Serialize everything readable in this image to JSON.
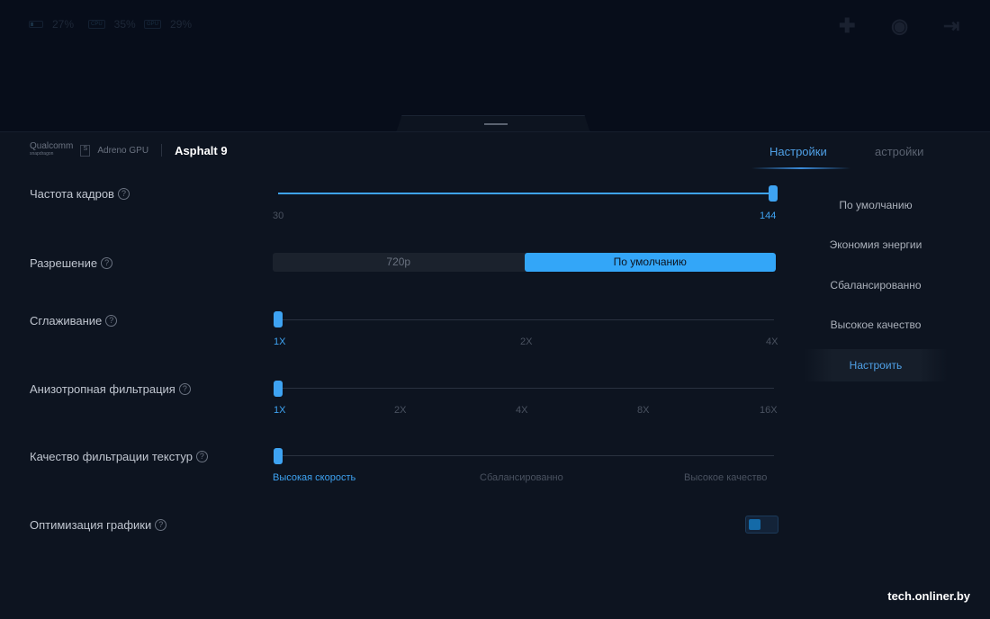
{
  "status": {
    "battery": "27%",
    "cpu_chip": "CPU",
    "cpu": "35%",
    "gpu_chip": "GPU",
    "gpu": "29%"
  },
  "header": {
    "brand": "Qualcomm",
    "brand_sub": "snapdragon",
    "gpu": "Adreno GPU",
    "game": "Asphalt 9",
    "tab_active": "Настройки",
    "tab_other": "астройки"
  },
  "settings": {
    "fps": {
      "label": "Частота кадров",
      "min": "30",
      "max": "144",
      "value": 144
    },
    "resolution": {
      "label": "Разрешение",
      "options": [
        "720p",
        "По умолчанию"
      ],
      "selected": "По умолчанию"
    },
    "aa": {
      "label": "Сглаживание",
      "ticks": [
        "1X",
        "2X",
        "4X"
      ],
      "selected": "1X"
    },
    "aniso": {
      "label": "Анизотропная фильтрация",
      "ticks": [
        "1X",
        "2X",
        "4X",
        "8X",
        "16X"
      ],
      "selected": "1X"
    },
    "texture": {
      "label": "Качество фильтрации текстур",
      "ticks": [
        "Высокая скорость",
        "Сбалансированно",
        "Высокое качество"
      ],
      "selected": "Высокая скорость"
    },
    "optimize": {
      "label": "Оптимизация графики",
      "enabled": true
    }
  },
  "presets": [
    "По умолчанию",
    "Экономия энергии",
    "Сбалансированно",
    "Высокое качество",
    "Настроить"
  ],
  "preset_selected": "Настроить",
  "help": "?",
  "watermark": "tech.onliner.by"
}
